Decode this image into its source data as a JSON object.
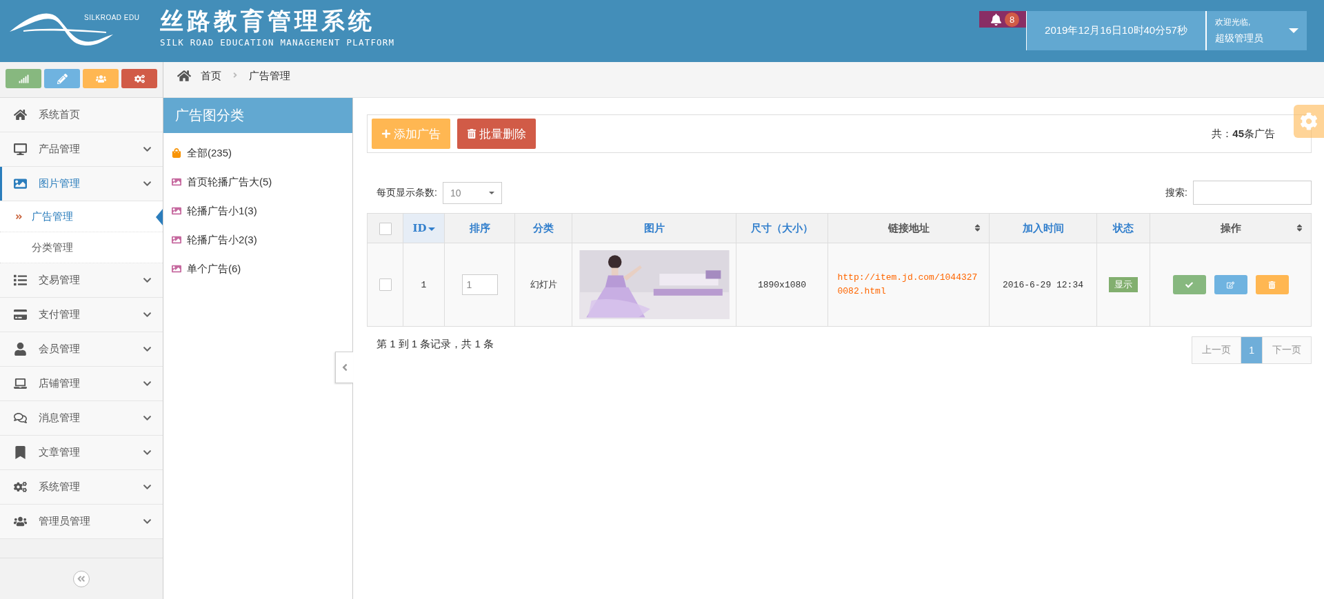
{
  "header": {
    "logo_text": "SILKROAD EDU",
    "title": "丝路教育管理系统",
    "subtitle": "SILK ROAD EDUCATION MANAGEMENT PLATFORM",
    "notifications": "8",
    "datetime": "2019年12月16日10时40分57秒",
    "welcome": "欢迎光临,",
    "user": "超级管理员"
  },
  "sidebar": {
    "shortcuts": [
      {
        "kind": "stats"
      },
      {
        "kind": "edit"
      },
      {
        "kind": "users"
      },
      {
        "kind": "settings"
      }
    ],
    "items": [
      {
        "label": "系统首页",
        "kind": "link",
        "selected": false
      },
      {
        "label": "产品管理",
        "kind": "menu",
        "selected": false
      },
      {
        "label": "图片管理",
        "kind": "menu",
        "selected": true,
        "children": [
          {
            "label": "广告管理",
            "selected": true
          },
          {
            "label": "分类管理",
            "selected": false
          }
        ]
      },
      {
        "label": "交易管理",
        "kind": "menu",
        "selected": false
      },
      {
        "label": "支付管理",
        "kind": "menu",
        "selected": false
      },
      {
        "label": "会员管理",
        "kind": "menu",
        "selected": false
      },
      {
        "label": "店铺管理",
        "kind": "menu",
        "selected": false
      },
      {
        "label": "消息管理",
        "kind": "menu",
        "selected": false
      },
      {
        "label": "文章管理",
        "kind": "menu",
        "selected": false
      },
      {
        "label": "系统管理",
        "kind": "menu",
        "selected": false
      },
      {
        "label": "管理员管理",
        "kind": "menu",
        "selected": false
      }
    ]
  },
  "breadcrumb": [
    "首页",
    "广告管理"
  ],
  "categories": {
    "title": "广告图分类",
    "items": [
      {
        "label": "全部(235)",
        "kind": "all"
      },
      {
        "label": "首页轮播广告大(5)",
        "kind": "category"
      },
      {
        "label": "轮播广告小1(3)",
        "kind": "category"
      },
      {
        "label": "轮播广告小2(3)",
        "kind": "category"
      },
      {
        "label": "单个广告(6)",
        "kind": "category"
      }
    ]
  },
  "toolbar": {
    "buttons": [
      {
        "label": "添加广告",
        "kind": "add"
      },
      {
        "label": "批量删除",
        "kind": "delete"
      }
    ],
    "total": "共：**45**条广告"
  },
  "page_size": {
    "label": "每页显示条数:",
    "value": "10"
  },
  "search": {
    "label": "搜索:"
  },
  "table": {
    "select_all": {
      "checked": false
    },
    "columns": [
      {
        "label": "ID",
        "sorted": true,
        "sortable": false
      },
      {
        "label": "排序",
        "sorted": false,
        "sortable": false
      },
      {
        "label": "分类",
        "sorted": false,
        "sortable": false
      },
      {
        "label": "图片",
        "sorted": false,
        "sortable": false
      },
      {
        "label": "尺寸（大小）",
        "sorted": false,
        "sortable": false
      },
      {
        "label": "链接地址",
        "sorted": false,
        "sortable": true
      },
      {
        "label": "加入时间",
        "sorted": false,
        "sortable": false
      },
      {
        "label": "状态",
        "sorted": false,
        "sortable": false
      },
      {
        "label": "操作",
        "sorted": false,
        "sortable": true
      }
    ],
    "rows": [
      {
        "checked": false,
        "id": "1",
        "order": "1",
        "category": "幻灯片",
        "picture": {
          "kind": "picture"
        },
        "size": "1890x1080",
        "link": "http://item.jd.com/10443270082.html",
        "added": "2016-6-29 12:34",
        "status": "显示",
        "actions": [
          {
            "kind": "approve"
          },
          {
            "kind": "edit"
          },
          {
            "kind": "delete"
          }
        ]
      }
    ]
  },
  "footer": {
    "info": "第 1 到 1 条记录，共 1 条",
    "pages": [
      {
        "label": "上一页",
        "selected": false,
        "disabled": true
      },
      {
        "label": "1",
        "selected": true,
        "disabled": false
      },
      {
        "label": "下一页",
        "selected": false,
        "disabled": true
      }
    ]
  }
}
